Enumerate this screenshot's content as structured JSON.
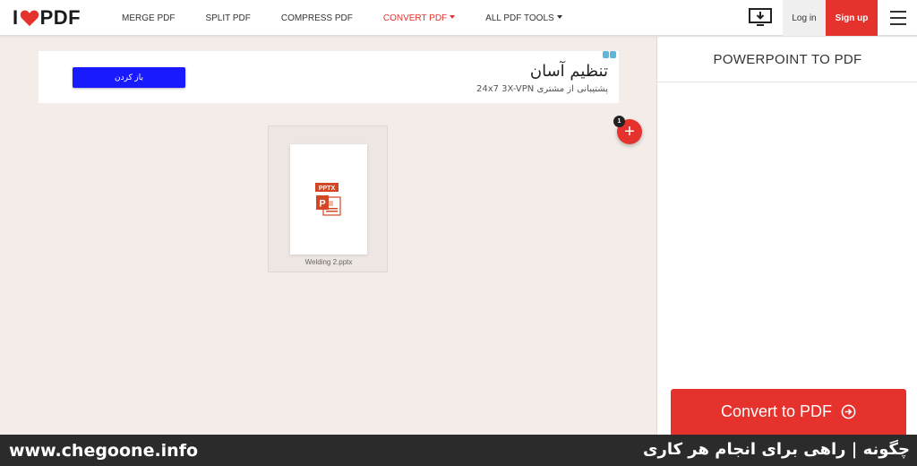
{
  "header": {
    "logo_left": "I",
    "logo_right": "PDF",
    "nav": [
      {
        "label": "MERGE PDF"
      },
      {
        "label": "SPLIT PDF"
      },
      {
        "label": "COMPRESS PDF"
      },
      {
        "label": "CONVERT PDF"
      },
      {
        "label": "ALL PDF TOOLS"
      }
    ],
    "login_label": "Log in",
    "signup_label": "Sign up"
  },
  "ad": {
    "title": "تنظیم آسان",
    "subtitle": "پشتیبانی از مشتری 24x7 3X-VPN",
    "button_label": "باز کردن"
  },
  "file": {
    "type_label": "PPTX",
    "app_letter": "P",
    "name": "Welding 2.pptx"
  },
  "file_count": "1",
  "add_symbol": "+",
  "sidebar": {
    "title": "POWERPOINT TO PDF",
    "convert_label": "Convert to PDF"
  },
  "footer": {
    "site": "www.chegoone.info",
    "tagline": "چگونه | راهی برای انجام هر کاری"
  },
  "colors": {
    "brand_red": "#e5322d",
    "ad_blue": "#1a1aff",
    "ppt_orange": "#d24726"
  }
}
